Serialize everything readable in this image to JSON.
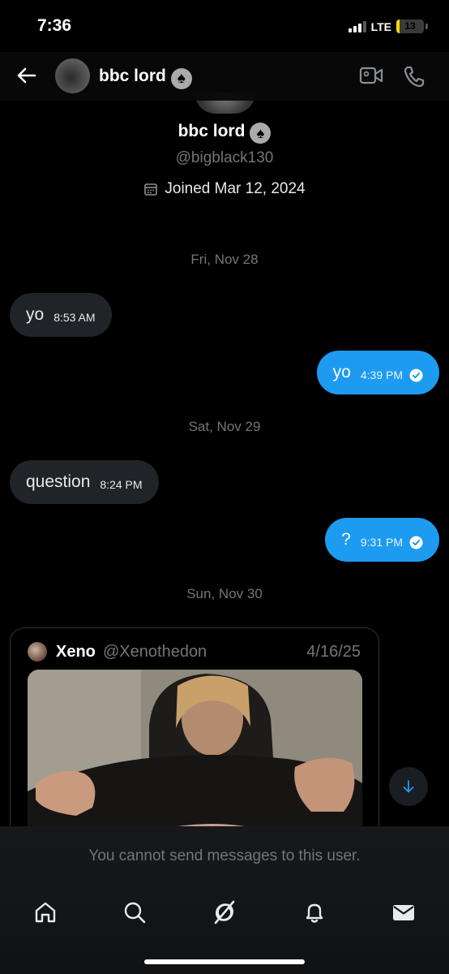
{
  "status_bar": {
    "time": "7:36",
    "network": "LTE",
    "battery": "13",
    "battery_level": 0.13
  },
  "header": {
    "name": "bbc lord",
    "emoji": "♠"
  },
  "profile": {
    "name": "bbc lord",
    "emoji": "♠",
    "handle": "@bigblack130",
    "joined": "Joined Mar 12, 2024"
  },
  "conversation": {
    "dates": [
      "Fri, Nov 28",
      "Sat, Nov 29",
      "Sun, Nov 30"
    ],
    "messages": [
      {
        "direction": "in",
        "text": "yo",
        "time": "8:53 AM"
      },
      {
        "direction": "out",
        "text": "yo",
        "time": "4:39 PM",
        "status": "read"
      },
      {
        "direction": "in",
        "text": "question",
        "time": "8:24 PM"
      },
      {
        "direction": "out",
        "text": "?",
        "time": "9:31 PM",
        "status": "read"
      }
    ]
  },
  "quoted_post": {
    "name": "Xeno",
    "handle": "@Xenothedon",
    "date": "4/16/25"
  },
  "composer": {
    "notice": "You cannot send messages to this user."
  },
  "tabbar": {
    "items": [
      "home-icon",
      "search-icon",
      "grok-icon",
      "notifications-icon",
      "messages-icon"
    ]
  },
  "colors": {
    "accent": "#1d9bf0",
    "incoming_bubble": "#202327",
    "secondary_text": "#71767b",
    "background": "#000000"
  }
}
